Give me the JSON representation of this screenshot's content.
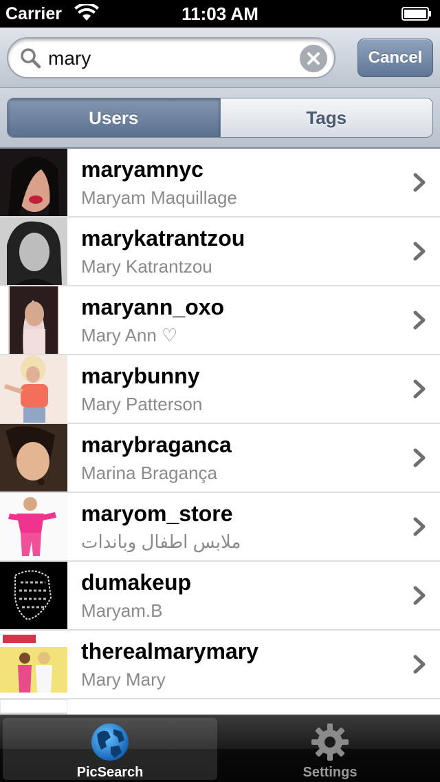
{
  "status_bar": {
    "carrier": "Carrier",
    "time": "11:03 AM"
  },
  "search": {
    "query": "mary",
    "cancel_label": "Cancel"
  },
  "segments": {
    "users_label": "Users",
    "tags_label": "Tags",
    "selected": "Users"
  },
  "results": [
    {
      "username": "maryamnyc",
      "fullname": "Maryam Maquillage"
    },
    {
      "username": "marykatrantzou",
      "fullname": "Mary Katrantzou"
    },
    {
      "username": "maryann_oxo",
      "fullname": "Mary Ann ♡"
    },
    {
      "username": "marybunny",
      "fullname": "Mary Patterson"
    },
    {
      "username": "marybraganca",
      "fullname": "Marina Bragança"
    },
    {
      "username": "maryom_store",
      "fullname": "ملابس اطفال وباندات"
    },
    {
      "username": "dumakeup",
      "fullname": "Maryam.B"
    },
    {
      "username": "therealmarymary",
      "fullname": "Mary Mary"
    }
  ],
  "tab_bar": {
    "tabs": [
      {
        "label": "PicSearch",
        "icon": "globe-icon",
        "active": true
      },
      {
        "label": "Settings",
        "icon": "gear-icon",
        "active": false
      }
    ]
  },
  "colors": {
    "accent": "#5b7191",
    "list_username": "#000000",
    "list_fullname": "#8a8a8a"
  }
}
